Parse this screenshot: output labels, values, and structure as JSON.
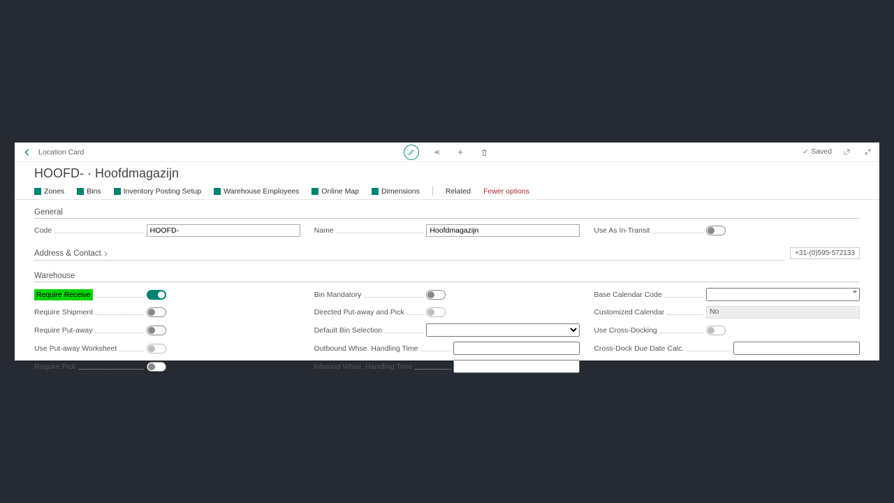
{
  "breadcrumb": "Location Card",
  "title": "HOOFD- · Hoofdmagazijn",
  "status": "Saved",
  "menu": {
    "zones": "Zones",
    "bins": "Bins",
    "inventory_posting": "Inventory Posting Setup",
    "warehouse_employees": "Warehouse Employees",
    "online_map": "Online Map",
    "dimensions": "Dimensions",
    "related": "Related",
    "fewer_options": "Fewer options"
  },
  "sections": {
    "general": "General",
    "address": "Address & Contact",
    "warehouse": "Warehouse"
  },
  "general": {
    "code_label": "Code",
    "code_value": "HOOFD-",
    "name_label": "Name",
    "name_value": "Hoofdmagazijn",
    "transit_label": "Use As In-Transit"
  },
  "address": {
    "phone": "+31-(0)595-572133"
  },
  "warehouse": {
    "require_receive": "Require Receive",
    "require_shipment": "Require Shipment",
    "require_putaway": "Require Put-away",
    "use_putaway_ws": "Use Put-away Worksheet",
    "require_pick": "Require Pick",
    "bin_mandatory": "Bin Mandatory",
    "directed_putaway": "Directed Put-away and Pick",
    "default_bin": "Default Bin Selection",
    "outbound_time": "Outbound Whse. Handling Time",
    "inbound_time": "Inbound Whse. Handling Time",
    "base_calendar": "Base Calendar Code",
    "customized_calendar": "Customized Calendar",
    "customized_calendar_val": "No",
    "use_crossdock": "Use Cross-Docking",
    "crossdock_due": "Cross-Dock Due Date Calc."
  }
}
